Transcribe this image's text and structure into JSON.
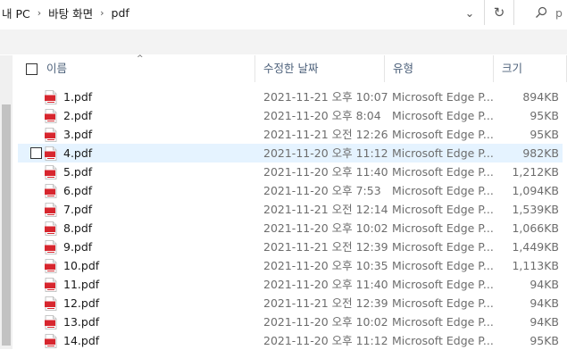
{
  "address": {
    "crumbs": [
      "내 PC",
      "바탕 화면",
      "pdf"
    ],
    "separator": "›",
    "dropdown_glyph": "⌄",
    "refresh_glyph": "↻",
    "search_placeholder": "p"
  },
  "header": {
    "name": "이름",
    "date": "수정한 날짜",
    "type": "유형",
    "size": "크기",
    "sort_glyph": "^"
  },
  "colors": {
    "highlight": "#e5f3ff",
    "pdf_icon": "#d7262e"
  },
  "files": [
    {
      "name": "1.pdf",
      "date": "2021-11-21 오후 10:07",
      "type": "Microsoft Edge P...",
      "size": "894KB"
    },
    {
      "name": "2.pdf",
      "date": "2021-11-20 오후 8:04",
      "type": "Microsoft Edge P...",
      "size": "95KB"
    },
    {
      "name": "3.pdf",
      "date": "2021-11-21 오전 12:26",
      "type": "Microsoft Edge P...",
      "size": "95KB"
    },
    {
      "name": "4.pdf",
      "date": "2021-11-20 오후 11:12",
      "type": "Microsoft Edge P...",
      "size": "982KB",
      "highlighted": true
    },
    {
      "name": "5.pdf",
      "date": "2021-11-20 오후 11:40",
      "type": "Microsoft Edge P...",
      "size": "1,212KB"
    },
    {
      "name": "6.pdf",
      "date": "2021-11-20 오후 7:53",
      "type": "Microsoft Edge P...",
      "size": "1,094KB"
    },
    {
      "name": "7.pdf",
      "date": "2021-11-21 오전 12:14",
      "type": "Microsoft Edge P...",
      "size": "1,539KB"
    },
    {
      "name": "8.pdf",
      "date": "2021-11-20 오후 10:02",
      "type": "Microsoft Edge P...",
      "size": "1,066KB"
    },
    {
      "name": "9.pdf",
      "date": "2021-11-21 오전 12:39",
      "type": "Microsoft Edge P...",
      "size": "1,449KB"
    },
    {
      "name": "10.pdf",
      "date": "2021-11-20 오후 10:35",
      "type": "Microsoft Edge P...",
      "size": "1,113KB"
    },
    {
      "name": "11.pdf",
      "date": "2021-11-20 오후 11:40",
      "type": "Microsoft Edge P...",
      "size": "94KB"
    },
    {
      "name": "12.pdf",
      "date": "2021-11-21 오전 12:39",
      "type": "Microsoft Edge P...",
      "size": "94KB"
    },
    {
      "name": "13.pdf",
      "date": "2021-11-20 오후 10:02",
      "type": "Microsoft Edge P...",
      "size": "94KB"
    },
    {
      "name": "14.pdf",
      "date": "2021-11-20 오후 11:12",
      "type": "Microsoft Edge P...",
      "size": "95KB"
    }
  ]
}
